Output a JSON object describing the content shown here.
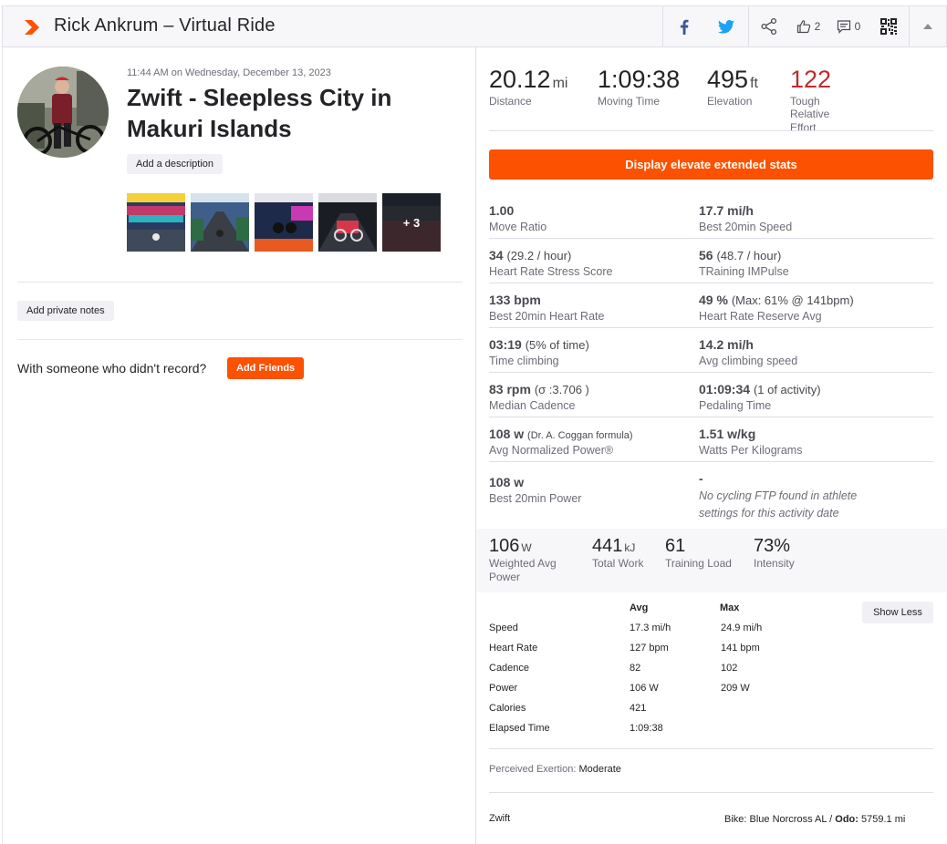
{
  "header": {
    "title": "Rick Ankrum – Virtual Ride",
    "kudos_count": "2",
    "comments_count": "0"
  },
  "activity": {
    "time": "11:44 AM on Wednesday, December 13, 2023",
    "name": "Zwift - Sleepless City in Makuri Islands",
    "add_description": "Add a description",
    "more_photos": "+ 3",
    "add_private_notes": "Add private notes",
    "with_someone": "With someone who didn't record?",
    "add_friends": "Add Friends"
  },
  "top_stats": {
    "distance": {
      "value": "20.12",
      "unit": "mi",
      "label": "Distance"
    },
    "moving_time": {
      "value": "1:09:38",
      "label": "Moving Time"
    },
    "elevation": {
      "value": "495",
      "unit": "ft",
      "label": "Elevation"
    },
    "effort": {
      "value": "122",
      "label_1": "Tough Relative",
      "label_2": "Effort"
    }
  },
  "elevate_button": "Display elevate extended stats",
  "extended_stats": [
    {
      "left": {
        "value": "1.00",
        "label": "Move Ratio"
      },
      "right": {
        "value": "17.7 mi/h",
        "label": "Best 20min Speed"
      }
    },
    {
      "left": {
        "value": "34",
        "sub": "(29.2 / hour)",
        "label": "Heart Rate Stress Score"
      },
      "right": {
        "value": "56",
        "sub": "(48.7 / hour)",
        "label": "TRaining IMPulse"
      }
    },
    {
      "left": {
        "value": "133 bpm",
        "label": "Best 20min Heart Rate"
      },
      "right": {
        "value": "49 %",
        "sub": "(Max: 61% @ 141bpm)",
        "label": "Heart Rate Reserve Avg"
      }
    },
    {
      "left": {
        "value": "03:19",
        "sub": "(5% of time)",
        "label": "Time climbing"
      },
      "right": {
        "value": "14.2 mi/h",
        "label": "Avg climbing speed"
      }
    },
    {
      "left": {
        "value": "83 rpm",
        "sub": "(σ :3.706 )",
        "label": "Median Cadence"
      },
      "right": {
        "value": "01:09:34",
        "sub": "(1 of activity)",
        "label": "Pedaling Time"
      }
    },
    {
      "left": {
        "value": "108 w",
        "sub": "(Dr. A. Coggan formula)",
        "label": "Avg Normalized Power®"
      },
      "right": {
        "value": "1.51 w/kg",
        "label": "Watts Per Kilograms"
      }
    },
    {
      "left": {
        "value": "108 w",
        "label": "Best 20min Power"
      },
      "right": {
        "value": "-",
        "note_1": "No cycling FTP found in athlete",
        "note_2": "settings for this activity date"
      }
    }
  ],
  "power_stats": {
    "weighted_avg": {
      "value": "106",
      "unit": "W",
      "label_1": "Weighted Avg",
      "label_2": "Power"
    },
    "total_work": {
      "value": "441",
      "unit": "kJ",
      "label": "Total Work"
    },
    "training_load": {
      "value": "61",
      "label": "Training Load"
    },
    "intensity": {
      "value": "73%",
      "label": "Intensity"
    }
  },
  "more_stats": {
    "col_avg": "Avg",
    "col_max": "Max",
    "show_less": "Show Less",
    "rows": [
      {
        "label": "Speed",
        "avg": "17.3 mi/h",
        "max": "24.9 mi/h"
      },
      {
        "label": "Heart Rate",
        "avg": "127 bpm",
        "max": "141 bpm"
      },
      {
        "label": "Cadence",
        "avg": "82",
        "max": "102"
      },
      {
        "label": "Power",
        "avg": "106 W",
        "max": "209 W"
      },
      {
        "label": "Calories",
        "avg": "421",
        "max": ""
      },
      {
        "label": "Elapsed Time",
        "avg": "1:09:38",
        "max": ""
      }
    ]
  },
  "exertion": {
    "label": "Perceived Exertion:",
    "value": "Moderate"
  },
  "device": "Zwift",
  "bike": {
    "label": "Bike: Blue Norcross AL /",
    "odo_label": "Odo:",
    "odo_value": "5759.1 mi"
  },
  "colors": {
    "brand": "#fc5200",
    "effort_red": "#bf2a2e",
    "facebook": "#3b5998",
    "twitter": "#1da1f2"
  }
}
